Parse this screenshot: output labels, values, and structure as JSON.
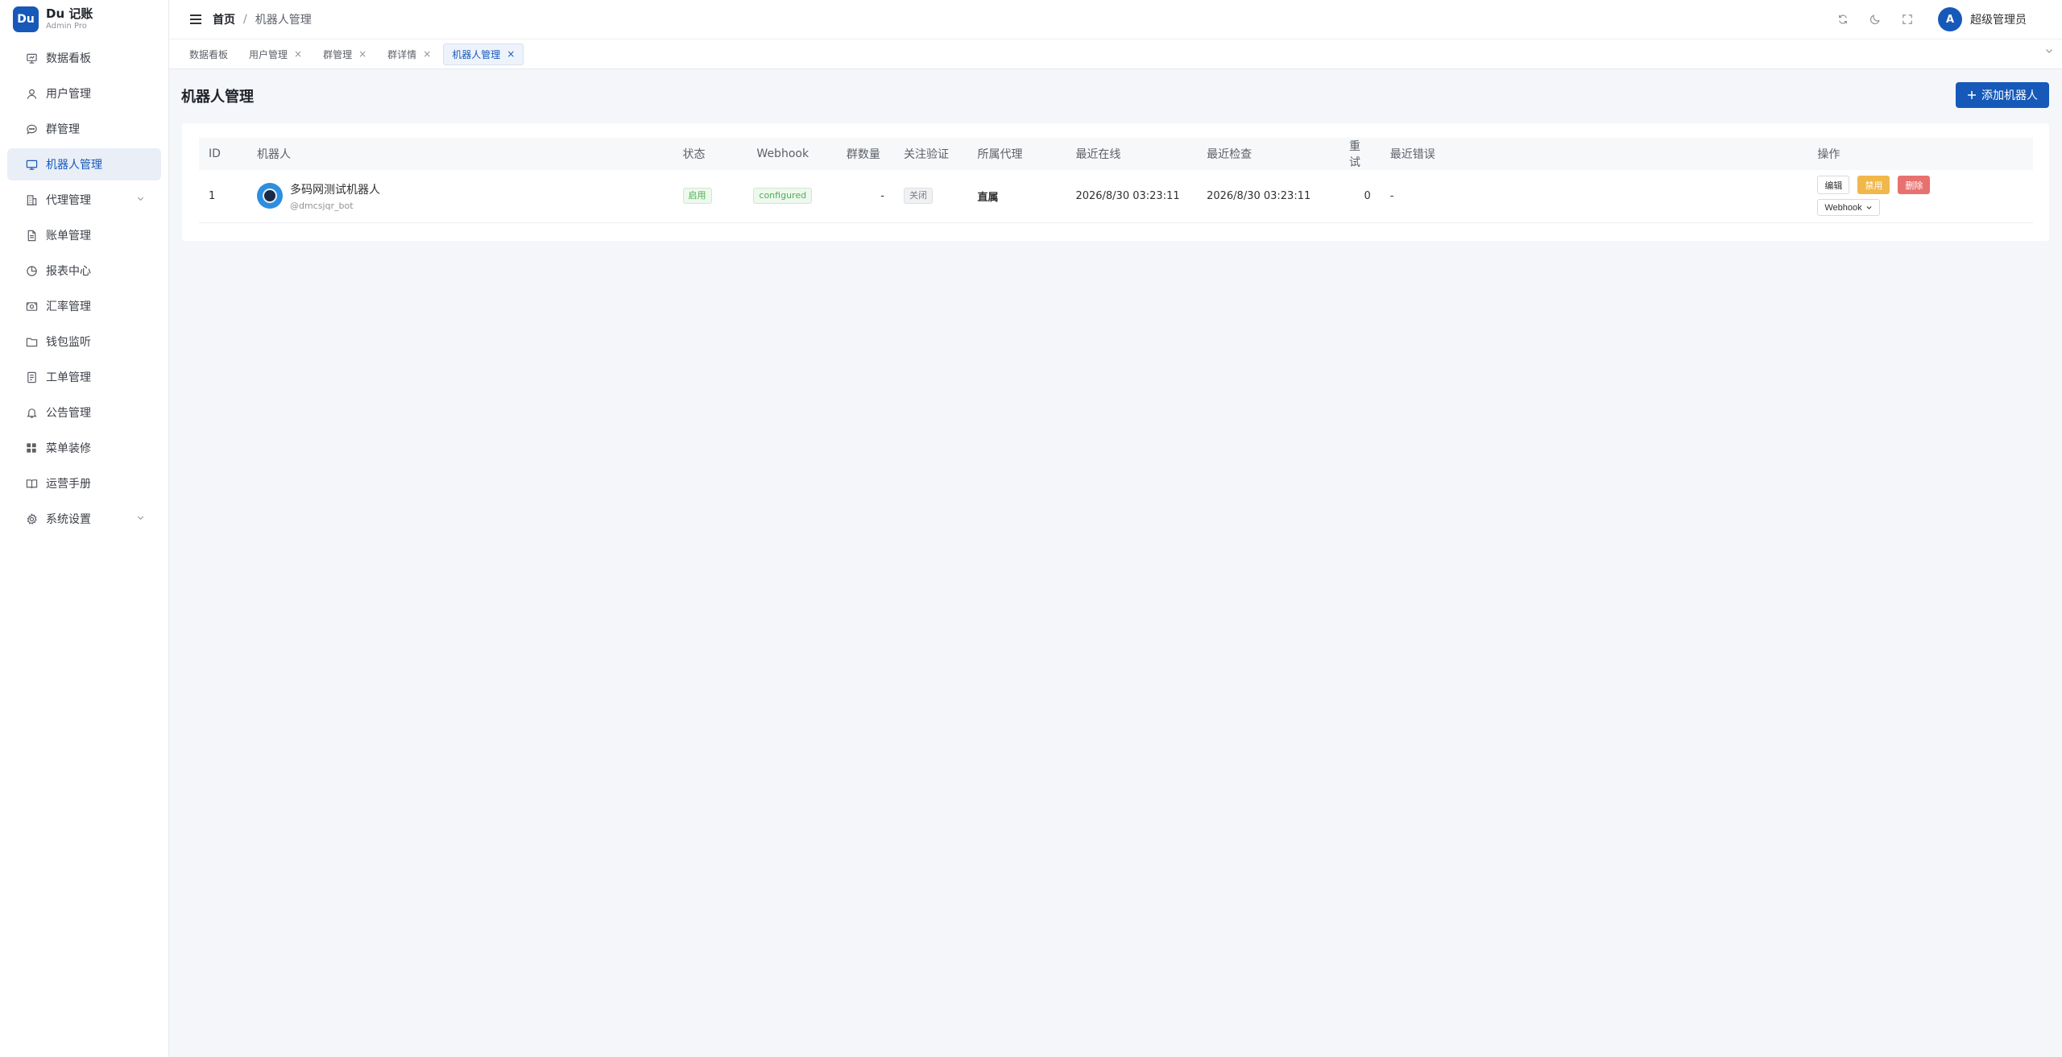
{
  "brand": {
    "logo": "Du",
    "name": "Du 记账",
    "sub": "Admin Pro"
  },
  "sidebar": {
    "items": [
      {
        "label": "数据看板",
        "icon": "dashboard-icon",
        "active": false,
        "expandable": false
      },
      {
        "label": "用户管理",
        "icon": "user-icon",
        "active": false,
        "expandable": false
      },
      {
        "label": "群管理",
        "icon": "chat-icon",
        "active": false,
        "expandable": false
      },
      {
        "label": "机器人管理",
        "icon": "monitor-icon",
        "active": true,
        "expandable": false
      },
      {
        "label": "代理管理",
        "icon": "building-icon",
        "active": false,
        "expandable": true
      },
      {
        "label": "账单管理",
        "icon": "document-icon",
        "active": false,
        "expandable": false
      },
      {
        "label": "报表中心",
        "icon": "pie-chart-icon",
        "active": false,
        "expandable": false
      },
      {
        "label": "汇率管理",
        "icon": "money-icon",
        "active": false,
        "expandable": false
      },
      {
        "label": "钱包监听",
        "icon": "folder-icon",
        "active": false,
        "expandable": false
      },
      {
        "label": "工单管理",
        "icon": "ticket-icon",
        "active": false,
        "expandable": false
      },
      {
        "label": "公告管理",
        "icon": "bell-icon",
        "active": false,
        "expandable": false
      },
      {
        "label": "菜单装修",
        "icon": "grid-icon",
        "active": false,
        "expandable": false
      },
      {
        "label": "运营手册",
        "icon": "book-icon",
        "active": false,
        "expandable": false
      },
      {
        "label": "系统设置",
        "icon": "gear-icon",
        "active": false,
        "expandable": true
      }
    ]
  },
  "header": {
    "breadcrumb_home": "首页",
    "breadcrumb_sep": "/",
    "breadcrumb_current": "机器人管理",
    "user_initial": "A",
    "user_name": "超级管理员"
  },
  "tabs": [
    {
      "label": "数据看板",
      "closable": false,
      "active": false
    },
    {
      "label": "用户管理",
      "closable": true,
      "active": false
    },
    {
      "label": "群管理",
      "closable": true,
      "active": false
    },
    {
      "label": "群详情",
      "closable": true,
      "active": false
    },
    {
      "label": "机器人管理",
      "closable": true,
      "active": true
    }
  ],
  "page": {
    "title": "机器人管理",
    "add_button": "添加机器人"
  },
  "table": {
    "headers": {
      "id": "ID",
      "bot": "机器人",
      "status": "状态",
      "webhook": "Webhook",
      "groups": "群数量",
      "verify": "关注验证",
      "agent": "所属代理",
      "last_online": "最近在线",
      "last_check": "最近检查",
      "retry": "重试",
      "last_error": "最近错误",
      "actions": "操作"
    },
    "rows": [
      {
        "id": "1",
        "bot_name": "多码网测试机器人",
        "bot_handle": "@dmcsjqr_bot",
        "status": "启用",
        "webhook": "configured",
        "groups": "-",
        "verify": "关闭",
        "agent": "直属",
        "last_online": "2026/8/30 03:23:11",
        "last_check": "2026/8/30 03:23:11",
        "retry": "0",
        "last_error": "-",
        "actions": {
          "edit": "编辑",
          "disable": "禁用",
          "delete": "删除",
          "webhook": "Webhook"
        }
      }
    ]
  },
  "colors": {
    "primary": "#1659b8",
    "warning": "#f0b74a",
    "danger": "#e87170",
    "success": "#4caf50",
    "background": "#f4f6f9"
  }
}
